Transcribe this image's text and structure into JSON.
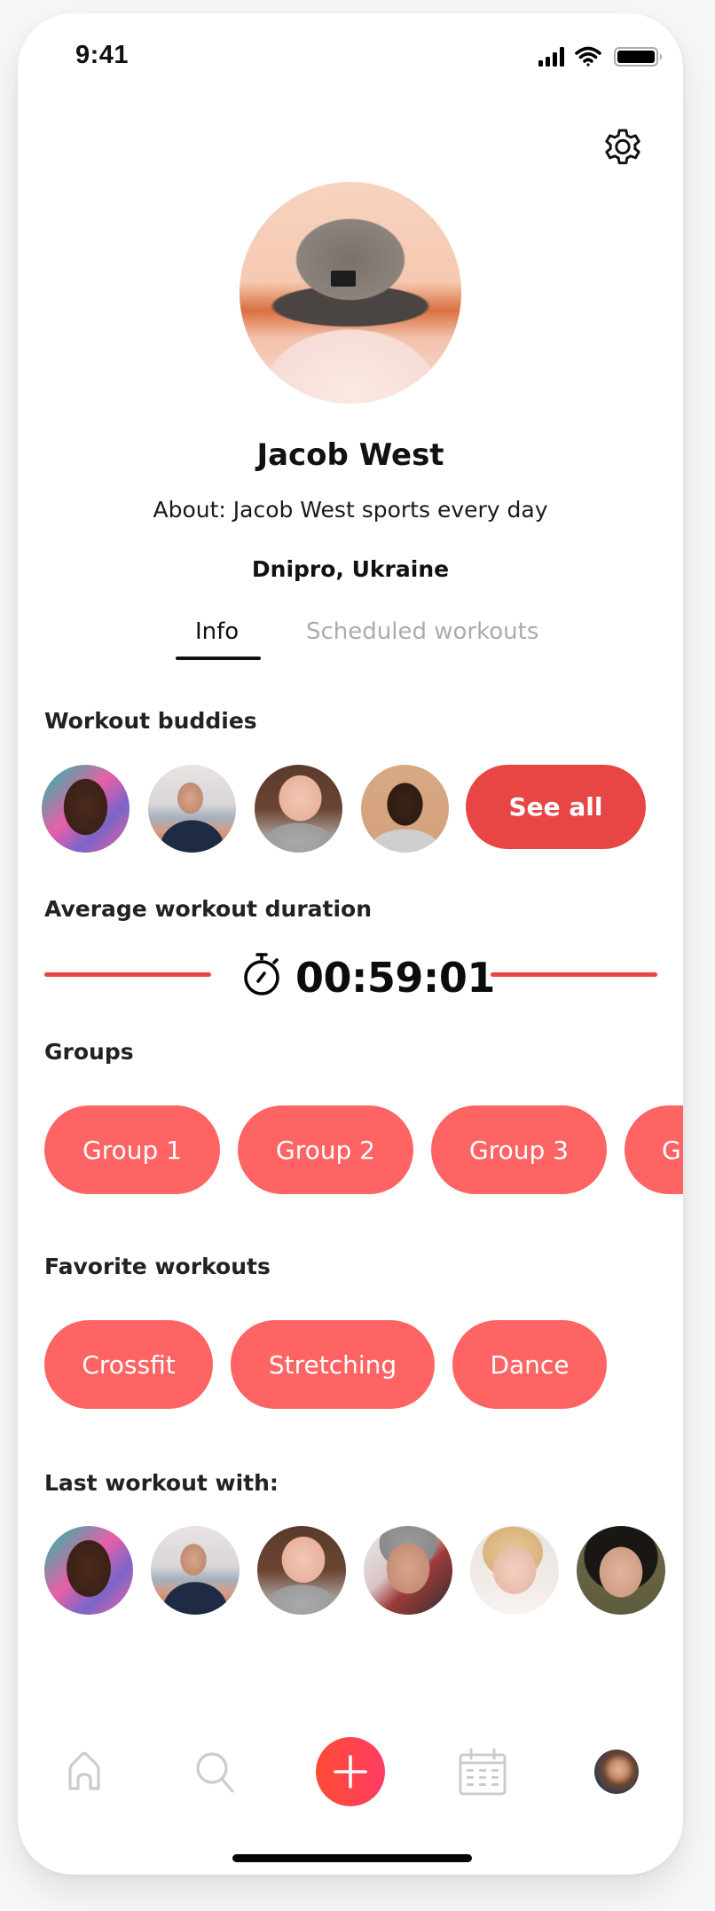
{
  "status_bar": {
    "time": "9:41",
    "icons": [
      "cellular-signal-icon",
      "wifi-icon",
      "battery-icon"
    ]
  },
  "header": {
    "settings_icon": "gear-icon"
  },
  "profile": {
    "name": "Jacob West",
    "about": "About: Jacob West sports every day",
    "location": "Dnipro, Ukraine"
  },
  "tabs": [
    {
      "label": "Info",
      "active": true
    },
    {
      "label": "Scheduled workouts",
      "active": false
    }
  ],
  "workout_buddies": {
    "title": "Workout buddies",
    "avatars": [
      "buddy-1",
      "buddy-2",
      "buddy-3",
      "buddy-4"
    ],
    "see_all_label": "See all"
  },
  "average_duration": {
    "title": "Average workout duration",
    "icon": "stopwatch-icon",
    "value": "00:59:01"
  },
  "groups": {
    "title": "Groups",
    "items": [
      "Group 1",
      "Group 2",
      "Group 3",
      "Gr"
    ]
  },
  "favorite_workouts": {
    "title": "Favorite workouts",
    "items": [
      "Crossfit",
      "Stretching",
      "Dance"
    ]
  },
  "last_workout": {
    "title": "Last workout with:",
    "avatars": [
      "person-1",
      "person-2",
      "person-3",
      "person-4",
      "person-5",
      "person-6"
    ]
  },
  "bottom_nav": {
    "items": [
      "home-icon",
      "search-icon",
      "plus-icon",
      "calendar-icon",
      "profile-avatar"
    ]
  },
  "colors": {
    "accent": "#e84545",
    "chip": "#ff6464",
    "plus_gradient_start": "#ff4b33",
    "plus_gradient_end": "#ff3d64",
    "inactive_tab": "#ababab",
    "nav_icon": "#cccccc"
  }
}
